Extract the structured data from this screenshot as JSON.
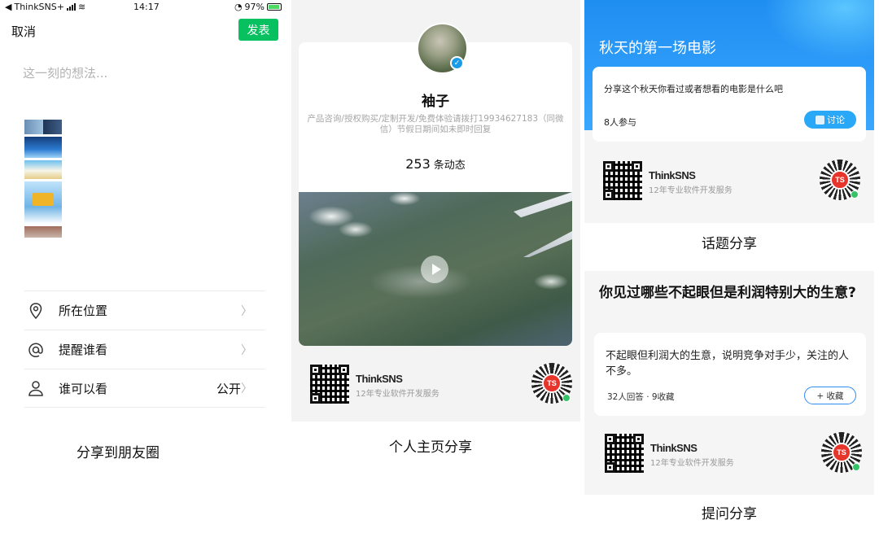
{
  "moments": {
    "status": {
      "carrier": "ThinkSNS+",
      "time": "14:17",
      "battery": "97%"
    },
    "cancel_label": "取消",
    "publish_label": "发表",
    "placeholder": "这一刻的想法...",
    "menu": [
      {
        "label": "所在位置",
        "value": "",
        "icon": "location-pin-icon"
      },
      {
        "label": "提醒谁看",
        "value": "",
        "icon": "at-sign-icon"
      },
      {
        "label": "谁可以看",
        "value": "公开",
        "icon": "person-icon"
      }
    ],
    "caption": "分享到朋友圈"
  },
  "profile": {
    "name": "袖子",
    "bio": "产品咨询/授权购买/定制开发/免费体验请拨打19934627183（同微信）节假日期间如未即时回复",
    "post_count": "253",
    "post_unit": "条动态",
    "caption": "个人主页分享"
  },
  "brand": {
    "name": "ThinkSNS",
    "slogan": "12年专业软件开发服务",
    "logo_text": "TS"
  },
  "topic": {
    "title": "秋天的第一场电影",
    "question": "分享这个秋天你看过或者想看的电影是什么吧",
    "participants": "8人参与",
    "discuss_label": "讨论",
    "caption": "话题分享"
  },
  "question": {
    "title": "你见过哪些不起眼但是利润特别大的生意?",
    "answer": "不起眼但利润大的生意，说明竞争对手少，关注的人不多。",
    "meta": "32人回答 · 9收藏",
    "favorite_label": "+ 收藏",
    "caption": "提问分享"
  },
  "colors": {
    "wechat_green": "#07c160",
    "topic_blue": "#1f8ef1",
    "accent_blue": "#29a8f7"
  }
}
